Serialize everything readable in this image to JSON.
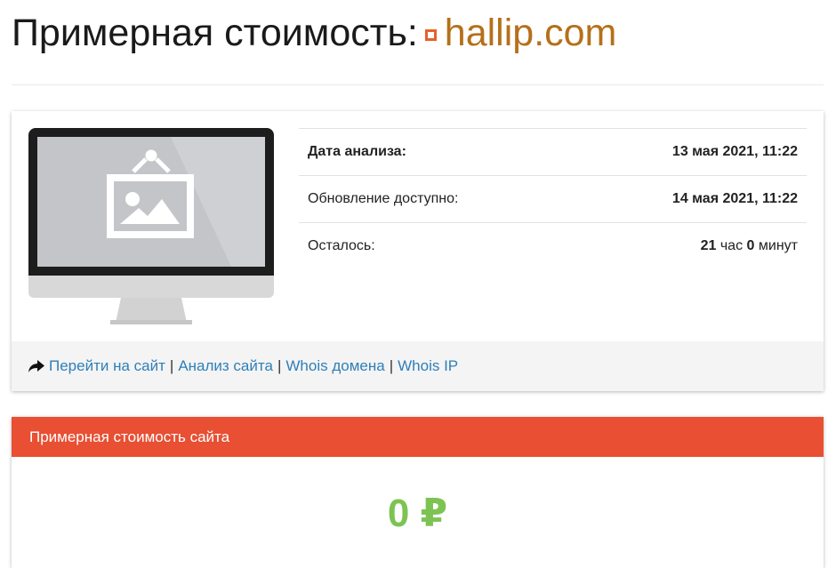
{
  "header": {
    "title_prefix": "Примерная стоимость:",
    "domain": "hallip.com"
  },
  "analysis": {
    "rows": [
      {
        "label": "Дата анализа:",
        "value": "13 мая 2021, 11:22"
      },
      {
        "label": "Обновление доступно:",
        "value": "14 мая 2021, 11:22"
      },
      {
        "label": "Осталось:",
        "hours": "21",
        "hours_unit": "час",
        "minutes": "0",
        "minutes_unit": "минут"
      }
    ]
  },
  "links": {
    "items": [
      "Перейти на сайт",
      "Анализ сайта",
      "Whois домена",
      "Whois IP"
    ],
    "separator": "|"
  },
  "cost": {
    "header": "Примерная стоимость сайта",
    "value": "0 ₽"
  },
  "colors": {
    "accent_red": "#e84f33",
    "domain_brown": "#b5701a",
    "link_blue": "#2f7fb8",
    "value_green": "#7dc353"
  },
  "icons": {
    "favicon": "square-favicon-icon",
    "screenshot": "monitor-placeholder-image",
    "footer_arrow": "share-arrow-icon"
  }
}
